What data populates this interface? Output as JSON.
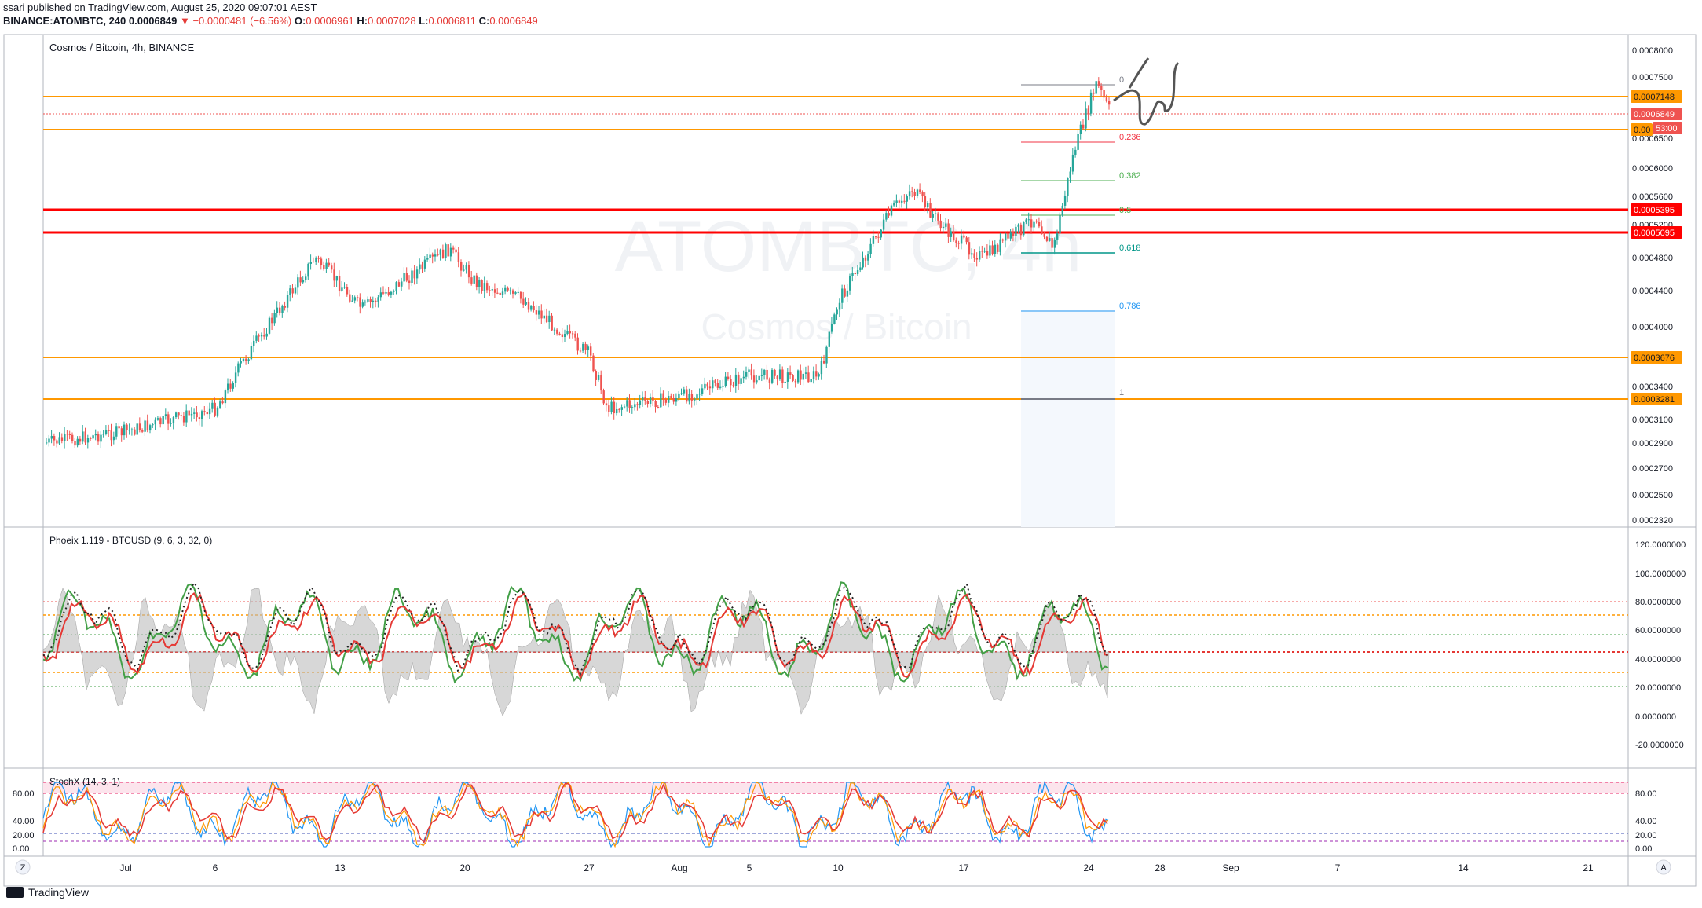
{
  "header": {
    "published": "ssari published on TradingView.com, August 25, 2020 09:07:01 AEST",
    "symbol": "BINANCE:ATOMBTC, 240",
    "last": "0.0006849",
    "change": "−0.0000481 (−6.56%)",
    "o_label": "O:",
    "o_val": "0.0006961",
    "h_label": "H:",
    "h_val": "0.0007028",
    "l_label": "L:",
    "l_val": "0.0006811",
    "c_label": "C:",
    "c_val": "0.0006849"
  },
  "main_pane": {
    "title": "Cosmos / Bitcoin, 4h, BINANCE",
    "watermark_symbol": "ATOMBTC, 4h",
    "watermark_name": "Cosmos / Bitcoin",
    "price_ticks": [
      "0.0008000",
      "0.0007500",
      "0.0006500",
      "0.0006000",
      "0.0005600",
      "0.0005200",
      "0.0004800",
      "0.0004400",
      "0.0004000",
      "0.0003400",
      "0.0003100",
      "0.0002900",
      "0.0002700",
      "0.0002500",
      "0.0002320"
    ],
    "price_labels": [
      {
        "text": "0.0007148",
        "color": "#ff9800"
      },
      {
        "text": "0.0006849",
        "color": "#ef5350"
      },
      {
        "text": "0.00",
        "color": "#ff9800"
      },
      {
        "text": "53:00",
        "color": "#ef5350"
      },
      {
        "text": "0.0005395",
        "color": "#ff0000"
      },
      {
        "text": "0.0005095",
        "color": "#ff0000"
      },
      {
        "text": "0.0003676",
        "color": "#ff9800"
      },
      {
        "text": "0.0003281",
        "color": "#ff9800"
      }
    ],
    "fib_levels": [
      {
        "label": "0",
        "color": "#787b86"
      },
      {
        "label": "0.236",
        "color": "#f23645"
      },
      {
        "label": "0.382",
        "color": "#4caf50"
      },
      {
        "label": "0.5",
        "color": "#4caf50"
      },
      {
        "label": "0.618",
        "color": "#009688"
      },
      {
        "label": "0.786",
        "color": "#2196f3"
      },
      {
        "label": "1",
        "color": "#787b86"
      }
    ]
  },
  "phoeix_pane": {
    "title": "Phoeix 1.119 - BTCUSD (9, 6, 3, 32, 0)",
    "ticks": [
      "120.0000000",
      "100.0000000",
      "80.0000000",
      "60.0000000",
      "40.0000000",
      "20.0000000",
      "0.0000000",
      "-20.0000000"
    ]
  },
  "stoch_pane": {
    "title": "StochX (14, 3, 1)",
    "ticks_left": [
      "80.00",
      "40.00",
      "20.00",
      "0.00"
    ],
    "ticks_right": [
      "80.00",
      "40.00",
      "20.00",
      "0.00"
    ]
  },
  "time_axis": {
    "labels": [
      "Jul",
      "6",
      "13",
      "20",
      "27",
      "Aug",
      "5",
      "10",
      "17",
      "24",
      "28",
      "Sep",
      "7",
      "14",
      "21"
    ],
    "left_button": "Z",
    "right_button": "A"
  },
  "brand": "TradingView",
  "colors": {
    "up": "#26a69a",
    "down": "#ef5350",
    "orange": "#ff9800",
    "red": "#ff0000",
    "green_line": "#43a047",
    "red_line": "#e53935"
  },
  "chart_data": {
    "type": "candlestick",
    "title": "Cosmos / Bitcoin, 4h, BINANCE",
    "x_range": [
      "2020-06-24",
      "2020-09-24"
    ],
    "y_range": [
      0.00023,
      0.00081
    ],
    "horizontal_levels": [
      0.0007148,
      0.0006849,
      0.0005395,
      0.0005095,
      0.0003676,
      0.0003281
    ],
    "price_path": [
      {
        "date": "Jun 24",
        "close": 0.00029
      },
      {
        "date": "Jul 1",
        "close": 0.0003
      },
      {
        "date": "Jul 6",
        "close": 0.00032
      },
      {
        "date": "Jul 8",
        "close": 0.00036
      },
      {
        "date": "Jul 11",
        "close": 0.00048
      },
      {
        "date": "Jul 15",
        "close": 0.00042
      },
      {
        "date": "Jul 19",
        "close": 0.00049
      },
      {
        "date": "Jul 21",
        "close": 0.00045
      },
      {
        "date": "Jul 25",
        "close": 0.00043
      },
      {
        "date": "Jul 27",
        "close": 0.00037
      },
      {
        "date": "Jul 28",
        "close": 0.00032
      },
      {
        "date": "Aug 1",
        "close": 0.00033
      },
      {
        "date": "Aug 5",
        "close": 0.00035
      },
      {
        "date": "Aug 9",
        "close": 0.00035
      },
      {
        "date": "Aug 10",
        "close": 0.00043
      },
      {
        "date": "Aug 13",
        "close": 0.00054
      },
      {
        "date": "Aug 14",
        "close": 0.00057
      },
      {
        "date": "Aug 16",
        "close": 0.00051
      },
      {
        "date": "Aug 18",
        "close": 0.00048
      },
      {
        "date": "Aug 21",
        "close": 0.00053
      },
      {
        "date": "Aug 22",
        "close": 0.00049
      },
      {
        "date": "Aug 23",
        "close": 0.00062
      },
      {
        "date": "Aug 24",
        "close": 0.00074
      },
      {
        "date": "Aug 25",
        "close": 0.0006849
      }
    ],
    "phoeix_levels": [
      80,
      70,
      55,
      44,
      30,
      20
    ],
    "stoch_bands": [
      90,
      80,
      20,
      10
    ]
  }
}
